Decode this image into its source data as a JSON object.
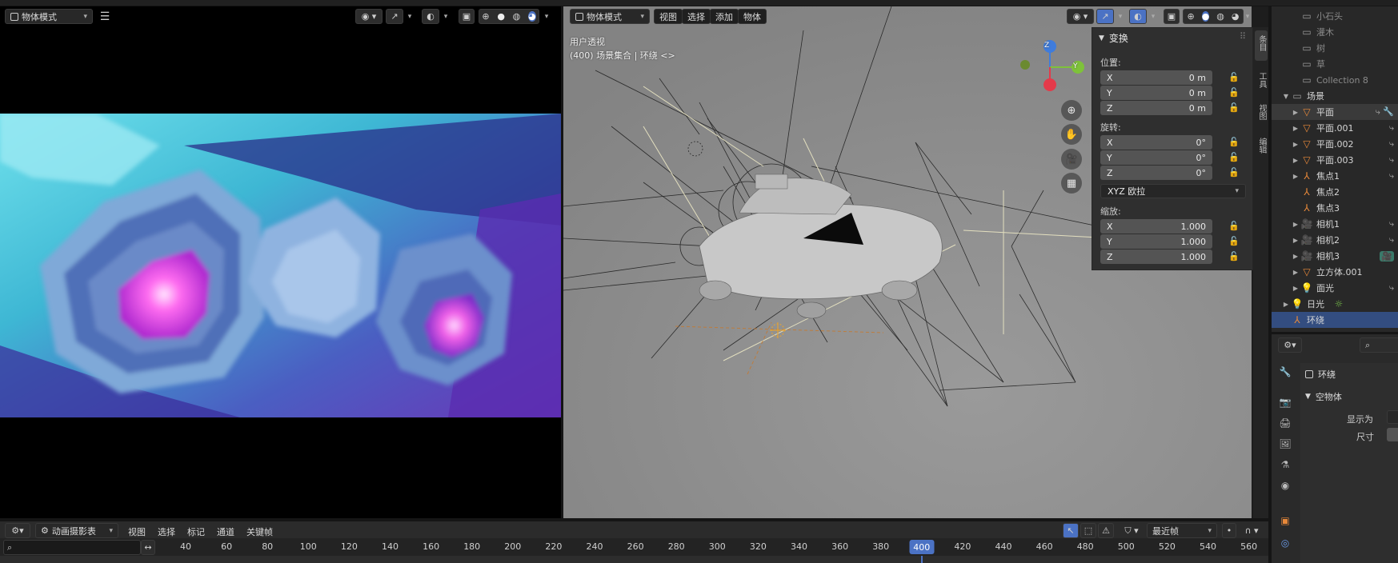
{
  "render_view": {
    "mode_label": "物体模式"
  },
  "viewport": {
    "mode_label": "物体模式",
    "menus": [
      "视图",
      "选择",
      "添加",
      "物体"
    ],
    "overlay_title": "用户透视",
    "overlay_subtitle": "(400) 场景集合 | 环绕 <>",
    "gizmo": {
      "x": "",
      "y": "Y",
      "z": "Z"
    }
  },
  "transform_panel": {
    "title": "变换",
    "location_label": "位置:",
    "location": [
      {
        "axis": "X",
        "value": "0 m"
      },
      {
        "axis": "Y",
        "value": "0 m"
      },
      {
        "axis": "Z",
        "value": "0 m"
      }
    ],
    "rotation_label": "旋转:",
    "rotation": [
      {
        "axis": "X",
        "value": "0°"
      },
      {
        "axis": "Y",
        "value": "0°"
      },
      {
        "axis": "Z",
        "value": "0°"
      }
    ],
    "rotation_mode": "XYZ 欧拉",
    "scale_label": "缩放:",
    "scale": [
      {
        "axis": "X",
        "value": "1.000"
      },
      {
        "axis": "Y",
        "value": "1.000"
      },
      {
        "axis": "Z",
        "value": "1.000"
      }
    ]
  },
  "npanel_tabs": [
    "条目",
    "工具",
    "视图",
    "编辑"
  ],
  "outliner": {
    "items": [
      {
        "label": "小石头",
        "icon": "collection-icon",
        "dim": true
      },
      {
        "label": "灌木",
        "icon": "collection-icon",
        "dim": true
      },
      {
        "label": "树",
        "icon": "collection-icon",
        "dim": true
      },
      {
        "label": "草",
        "icon": "collection-icon",
        "dim": true
      },
      {
        "label": "Collection 8",
        "icon": "collection-icon",
        "dim": true
      },
      {
        "label": "场景",
        "icon": "collection-icon",
        "dim": false
      },
      {
        "label": "平面",
        "icon": "mesh-icon",
        "dim": false
      },
      {
        "label": "平面.001",
        "icon": "mesh-icon",
        "dim": false
      },
      {
        "label": "平面.002",
        "icon": "mesh-icon",
        "dim": false
      },
      {
        "label": "平面.003",
        "icon": "mesh-icon",
        "dim": false
      },
      {
        "label": "焦点1",
        "icon": "empty-icon",
        "dim": false
      },
      {
        "label": "焦点2",
        "icon": "empty-icon",
        "dim": false
      },
      {
        "label": "焦点3",
        "icon": "empty-icon",
        "dim": false
      },
      {
        "label": "相机1",
        "icon": "camera-icon",
        "dim": false
      },
      {
        "label": "相机2",
        "icon": "camera-icon",
        "dim": false
      },
      {
        "label": "相机3",
        "icon": "camera-icon",
        "dim": false
      },
      {
        "label": "立方体.001",
        "icon": "mesh-icon",
        "dim": false
      },
      {
        "label": "面光",
        "icon": "light-icon",
        "dim": false
      },
      {
        "label": "日光",
        "icon": "light-icon",
        "dim": false
      },
      {
        "label": "环绕",
        "icon": "empty-icon",
        "dim": false
      }
    ]
  },
  "properties": {
    "object_name": "环绕",
    "section": "空物体",
    "display_as_label": "显示为",
    "size_label": "尺寸"
  },
  "timeline": {
    "editor_label": "动画摄影表",
    "menus": [
      "视图",
      "选择",
      "标记",
      "通道",
      "关键帧"
    ],
    "interp_label": "最近帧",
    "current_frame": 400,
    "ticks": [
      40,
      60,
      80,
      100,
      120,
      140,
      160,
      180,
      200,
      220,
      240,
      260,
      280,
      300,
      320,
      340,
      360,
      380,
      400,
      420,
      440,
      460,
      480,
      500,
      520,
      540,
      560
    ]
  },
  "colors": {
    "accent": "#4b72c4",
    "selection": "#334d80",
    "object_orange": "#e8893a"
  }
}
